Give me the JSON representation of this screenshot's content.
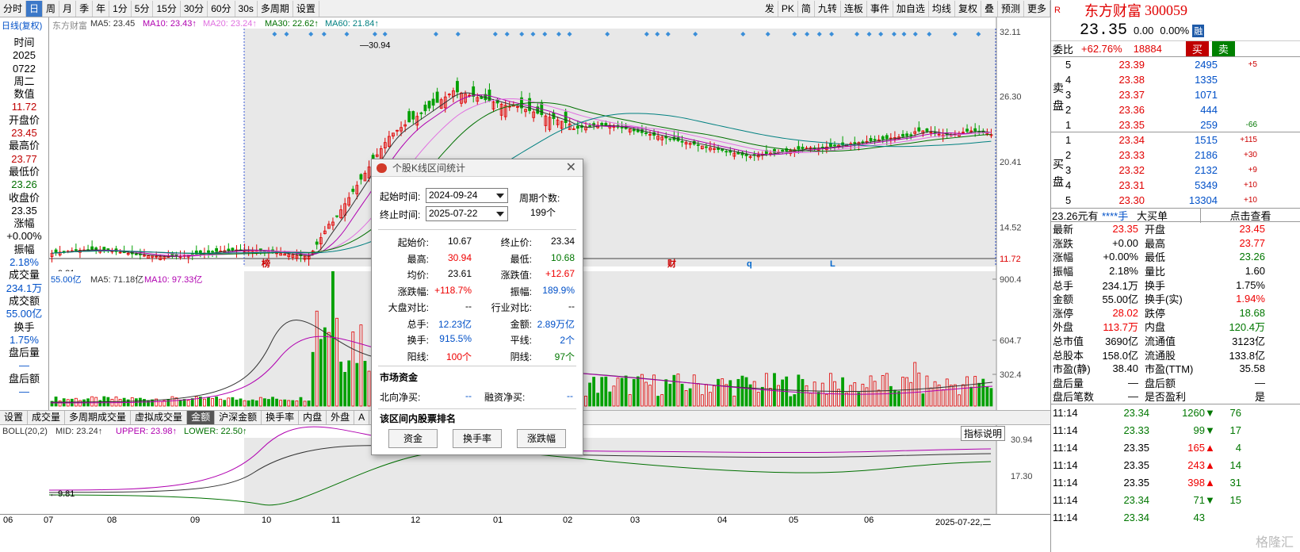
{
  "toolbar": {
    "left": [
      "分时",
      "日",
      "周",
      "月",
      "季",
      "年",
      "1分",
      "5分",
      "15分",
      "30分",
      "60分",
      "30s",
      "多周期",
      "设置"
    ],
    "active": "日",
    "right": [
      "发",
      "PK",
      "简",
      "九转",
      "连板",
      "事件",
      "加自选",
      "均线",
      "复权",
      "叠",
      "预测",
      "更多"
    ]
  },
  "kline_header": {
    "title": "日线(复权)",
    "stock": "东方财富",
    "ma5": "MA5: 23.45",
    "ma10": "MA10: 23.43↑",
    "ma20": "MA20: 23.24↑",
    "ma30": "MA30: 22.62↑",
    "ma60": "MA60: 21.84↑"
  },
  "price_axis": [
    "32.11",
    "26.30",
    "20.41",
    "14.52",
    "11.72"
  ],
  "kline_marks": {
    "high": "30.94",
    "low": "9.81",
    "markers": [
      "榜",
      "财",
      "q",
      "L"
    ]
  },
  "left_info": {
    "time_label": "时间",
    "year": "2025",
    "date": "0722",
    "weekday": "周二",
    "value_label": "数值",
    "value": "11.72",
    "open_label": "开盘价",
    "open": "23.45",
    "high_label": "最高价",
    "high": "23.77",
    "low_label": "最低价",
    "low": "23.26",
    "close_label": "收盘价",
    "close": "23.35",
    "chg_label": "涨幅",
    "chg": "+0.00%",
    "amp_label": "振幅",
    "amp": "2.18%",
    "vol_label": "成交量",
    "vol": "234.1万",
    "amt_label": "成交额",
    "amt": "55.00亿",
    "turn_label": "换手",
    "turn": "1.75%",
    "ah_vol_label": "盘后量",
    "ah_vol": "—",
    "ah_amt_label": "盘后额",
    "ah_amt": "—"
  },
  "volume_header": {
    "amt": "55.00亿",
    "ma5": "MA5: 71.18亿",
    "ma10": "MA10: 97.33亿"
  },
  "volume_axis": [
    "900.4",
    "604.7",
    "302.4"
  ],
  "bottom_tabs": [
    "设置",
    "成交量",
    "多周期成交量",
    "虚拟成交量",
    "金额",
    "沪深金额",
    "换手率",
    "内盘",
    "外盘",
    "A",
    "股变化",
    "融资融券变化",
    "机构探测器"
  ],
  "boll_header": {
    "name": "BOLL(20,2)",
    "mid": "MID: 23.24↑",
    "upper": "UPPER: 23.98↑",
    "lower": "LOWER: 22.50↑",
    "explain": "指标说明"
  },
  "boll_axis": [
    "30.94",
    "17.30"
  ],
  "boll_low": "9.81",
  "x_axis": [
    "06",
    "07",
    "08",
    "09",
    "10",
    "11",
    "12",
    "01",
    "02",
    "03",
    "04",
    "05",
    "06",
    "2025-07-22,二"
  ],
  "quote": {
    "r": "R",
    "name": "东方财富",
    "code": "300059",
    "price": "23.35",
    "change": "0.00",
    "pct": "0.00%",
    "badge": "融",
    "wb_label": "委比",
    "wb": "+62.76%",
    "wb_vol": "18884",
    "buy_btn": "买",
    "sell_btn": "卖",
    "sell": [
      {
        "lv": "5",
        "p": "23.39",
        "v": "2495",
        "d": "+5"
      },
      {
        "lv": "4",
        "p": "23.38",
        "v": "1335",
        "d": ""
      },
      {
        "lv": "3",
        "p": "23.37",
        "v": "1071",
        "d": ""
      },
      {
        "lv": "2",
        "p": "23.36",
        "v": "444",
        "d": ""
      },
      {
        "lv": "1",
        "p": "23.35",
        "v": "259",
        "d": "-66"
      }
    ],
    "buy": [
      {
        "lv": "1",
        "p": "23.34",
        "v": "1515",
        "d": "+115"
      },
      {
        "lv": "2",
        "p": "23.33",
        "v": "2186",
        "d": "+30"
      },
      {
        "lv": "3",
        "p": "23.32",
        "v": "2132",
        "d": "+9"
      },
      {
        "lv": "4",
        "p": "23.31",
        "v": "5349",
        "d": "+10"
      },
      {
        "lv": "5",
        "p": "23.30",
        "v": "13304",
        "d": "+10"
      }
    ],
    "sell_label": "卖盘",
    "buy_label": "买盘",
    "bigorder": {
      "a": "23.26元有",
      "b": "****手",
      "c": "大买单",
      "d": "点击查看"
    },
    "stats": [
      [
        "最新",
        "23.35",
        "开盘",
        "23.45"
      ],
      [
        "涨跌",
        "+0.00",
        "最高",
        "23.77"
      ],
      [
        "涨幅",
        "+0.00%",
        "最低",
        "23.26"
      ],
      [
        "振幅",
        "2.18%",
        "量比",
        "1.60"
      ],
      [
        "总手",
        "234.1万",
        "换手",
        "1.75%"
      ],
      [
        "金额",
        "55.00亿",
        "换手(实)",
        "1.94%"
      ],
      [
        "涨停",
        "28.02",
        "跌停",
        "18.68"
      ],
      [
        "外盘",
        "113.7万",
        "内盘",
        "120.4万"
      ],
      [
        "总市值",
        "3690亿",
        "流通值",
        "3123亿"
      ],
      [
        "总股本",
        "158.0亿",
        "流通股",
        "133.8亿"
      ],
      [
        "市盈(静)",
        "38.40",
        "市盈(TTM)",
        "35.58"
      ],
      [
        "盘后量",
        "—",
        "盘后额",
        "—"
      ],
      [
        "盘后笔数",
        "—",
        "是否盈利",
        "是"
      ]
    ],
    "ticks": [
      [
        "11:14",
        "23.34",
        "1260",
        "76",
        "down"
      ],
      [
        "11:14",
        "23.33",
        "99",
        "17",
        "down"
      ],
      [
        "11:14",
        "23.35",
        "165",
        "4",
        "up"
      ],
      [
        "11:14",
        "23.35",
        "243",
        "14",
        "up"
      ],
      [
        "11:14",
        "23.35",
        "398",
        "31",
        "up"
      ],
      [
        "11:14",
        "23.34",
        "71",
        "15",
        "down"
      ],
      [
        "11:14",
        "23.34",
        "43",
        "",
        ""
      ]
    ]
  },
  "dialog": {
    "title": "个股K线区间统计",
    "start_label": "起始时间:",
    "start": "2024-09-24",
    "end_label": "终止时间:",
    "end": "2025-07-22",
    "period_label": "周期个数:",
    "period": "199个",
    "stats": [
      [
        "起始价:",
        "10.67",
        "终止价:",
        "23.34"
      ],
      [
        "最高:",
        "30.94",
        "最低:",
        "10.68"
      ],
      [
        "均价:",
        "23.61",
        "涨跌值:",
        "+12.67"
      ],
      [
        "涨跌幅:",
        "+118.7%",
        "振幅:",
        "189.9%"
      ],
      [
        "大盘对比:",
        "--",
        "行业对比:",
        "--"
      ],
      [
        "总手:",
        "12.23亿",
        "金额:",
        "2.89万亿"
      ],
      [
        "换手:",
        "915.5%",
        "平线:",
        "2个"
      ],
      [
        "阳线:",
        "100个",
        "阴线:",
        "97个"
      ]
    ],
    "fund_title": "市场资金",
    "north_label": "北向净买:",
    "north": "--",
    "margin_label": "融资净买:",
    "margin": "--",
    "rank_title": "该区间内股票排名",
    "btns": [
      "资金",
      "换手率",
      "涨跌幅"
    ]
  },
  "watermark": "格隆汇"
}
